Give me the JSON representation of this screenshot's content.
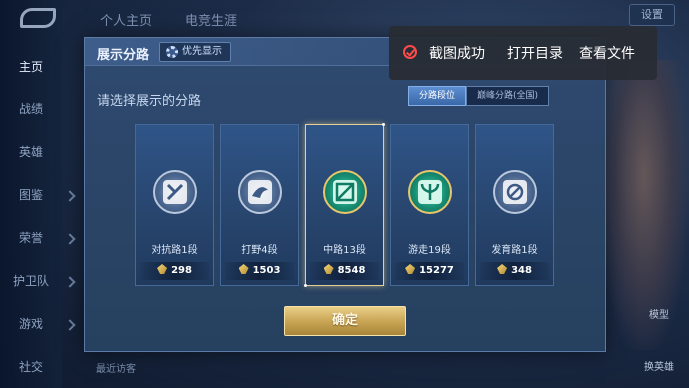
{
  "left_nav": {
    "items": [
      "主页",
      "战绩",
      "英雄",
      "图鉴",
      "荣誉",
      "护卫队",
      "游戏",
      "社交"
    ]
  },
  "top_tabs": [
    "个人主页",
    "电竞生涯"
  ],
  "top_right": {
    "settings_label": "设置"
  },
  "right_side": {
    "model_label": "模型",
    "change_hero_label": "换英雄"
  },
  "bottom_bar": {
    "text": "最近访客"
  },
  "dialog": {
    "title": "展示分路",
    "priority_label": "优先显示",
    "subtitle": "请选择展示的分路",
    "toggle": [
      "分路段位",
      "巅峰分路(全国)"
    ],
    "confirm_label": "确定"
  },
  "cards": [
    {
      "role": "对抗路1段",
      "score": "298",
      "emblem": "clash-lane-emblem-icon",
      "selected": false,
      "style": "silver"
    },
    {
      "role": "打野4段",
      "score": "1503",
      "emblem": "jungle-emblem-icon",
      "selected": false,
      "style": "silver"
    },
    {
      "role": "中路13段",
      "score": "8548",
      "emblem": "mid-lane-emblem-icon",
      "selected": true,
      "style": "green"
    },
    {
      "role": "游走19段",
      "score": "15277",
      "emblem": "roam-emblem-icon",
      "selected": false,
      "style": "green"
    },
    {
      "role": "发育路1段",
      "score": "348",
      "emblem": "farm-lane-emblem-icon",
      "selected": false,
      "style": "silver"
    }
  ],
  "toast": {
    "message": "截图成功",
    "open_dir": "打开目录",
    "view_file": "查看文件"
  },
  "colors": {
    "accent_gold": "#e6cf94",
    "toast_check": "#ff4a4a",
    "panel_blue": "#2f4a70"
  }
}
